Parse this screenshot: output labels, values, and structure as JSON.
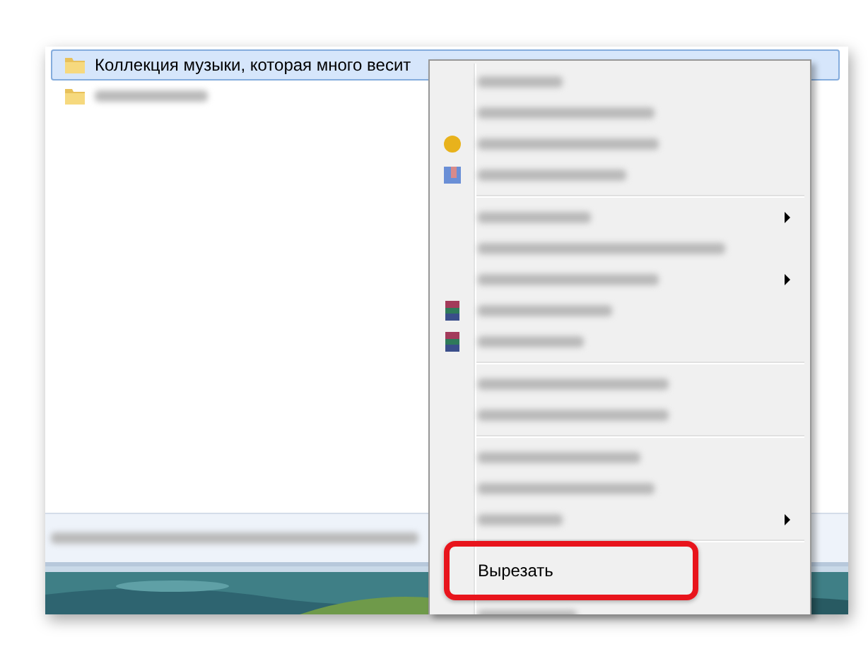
{
  "files": [
    {
      "kind": "named",
      "name": "Коллекция музыки, которая много весит",
      "selected": true
    },
    {
      "kind": "blurred",
      "selected": false
    }
  ],
  "context_menu": {
    "items": [
      {
        "kind": "plain"
      },
      {
        "kind": "plain"
      },
      {
        "kind": "shield"
      },
      {
        "kind": "box"
      },
      {
        "kind": "separator"
      },
      {
        "kind": "submenu"
      },
      {
        "kind": "plain"
      },
      {
        "kind": "submenu"
      },
      {
        "kind": "books"
      },
      {
        "kind": "books"
      },
      {
        "kind": "separator"
      },
      {
        "kind": "plain"
      },
      {
        "kind": "plain"
      },
      {
        "kind": "separator"
      },
      {
        "kind": "plain"
      },
      {
        "kind": "plain"
      },
      {
        "kind": "submenu"
      },
      {
        "kind": "separator"
      },
      {
        "kind": "text",
        "label": "Вырезать",
        "highlighted": true
      },
      {
        "kind": "plain"
      }
    ]
  }
}
